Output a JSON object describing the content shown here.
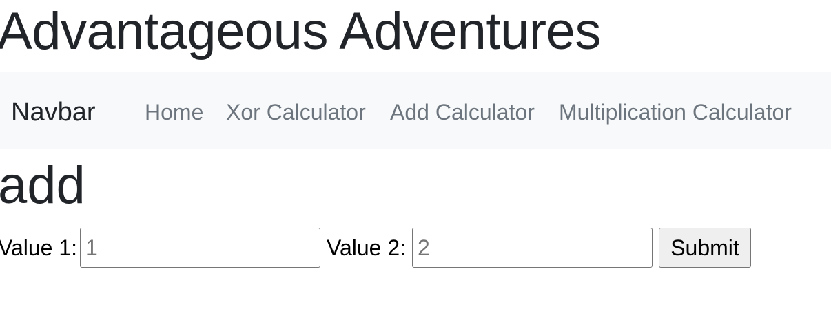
{
  "site": {
    "title": "Advantageous Adventures"
  },
  "navbar": {
    "brand": "Navbar",
    "links": [
      {
        "label": "Home"
      },
      {
        "label": "Xor Calculator"
      },
      {
        "label": "Add Calculator"
      },
      {
        "label": "Multiplication Calculator"
      }
    ]
  },
  "page": {
    "heading": "add"
  },
  "form": {
    "value1": {
      "label": "Value 1:",
      "value": "",
      "placeholder": "1"
    },
    "value2": {
      "label": "Value 2:",
      "value": "",
      "placeholder": "2"
    },
    "submit_label": "Submit"
  }
}
